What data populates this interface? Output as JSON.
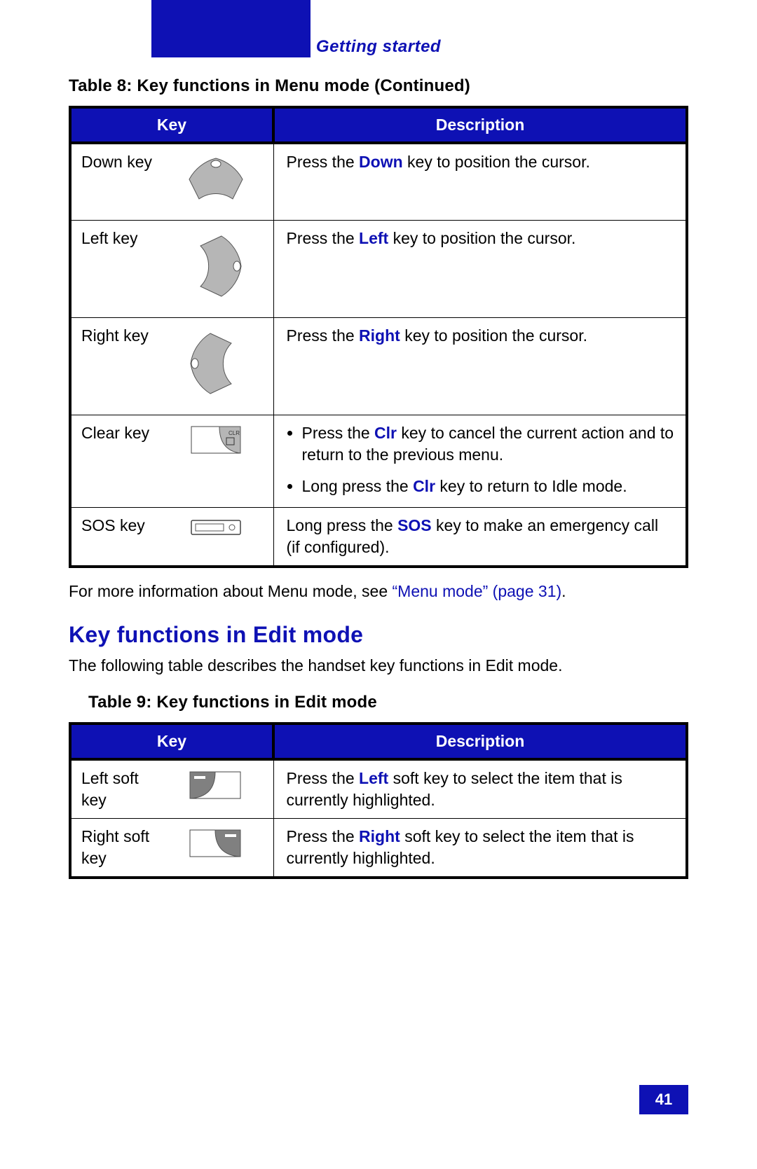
{
  "header": {
    "section": "Getting started"
  },
  "page_number": "41",
  "table8": {
    "caption": "Table 8: Key functions in Menu mode (Continued)",
    "columns": {
      "key": "Key",
      "desc": "Description"
    },
    "rows": {
      "down": {
        "name": "Down key",
        "pre": "Press the ",
        "hl": "Down",
        "post": " key to position the cursor."
      },
      "left": {
        "name": "Left key",
        "pre": "Press the ",
        "hl": "Left",
        "post": " key to position the cursor."
      },
      "right": {
        "name": "Right key",
        "pre": "Press the ",
        "hl": "Right",
        "post": " key to position the cursor."
      },
      "clear": {
        "name": "Clear key",
        "b1_pre": "Press the ",
        "b1_hl": "Clr",
        "b1_post": " key to cancel the current action and to return to the previous menu.",
        "b2_pre": "Long press the ",
        "b2_hl": "Clr",
        "b2_post": " key to return to Idle mode."
      },
      "sos": {
        "name": "SOS key",
        "pre": "Long press the ",
        "hl": "SOS",
        "post": " key to make an emergency call (if configured)."
      }
    }
  },
  "para_more": {
    "pre": "For more information about Menu mode, see ",
    "link": "“Menu mode” (page 31)",
    "post": "."
  },
  "subhead": "Key functions in Edit mode",
  "para_edit_intro": "The following table describes the handset key functions in Edit mode.",
  "table9": {
    "caption": "Table 9: Key functions in Edit mode",
    "columns": {
      "key": "Key",
      "desc": "Description"
    },
    "rows": {
      "lsk": {
        "name": "Left soft key",
        "pre": "Press the ",
        "hl": "Left",
        "post": " soft key to select the item that is currently highlighted."
      },
      "rsk": {
        "name": "Right soft key",
        "pre": "Press the ",
        "hl": "Right",
        "post": " soft key to select the item that is currently highlighted."
      }
    }
  }
}
